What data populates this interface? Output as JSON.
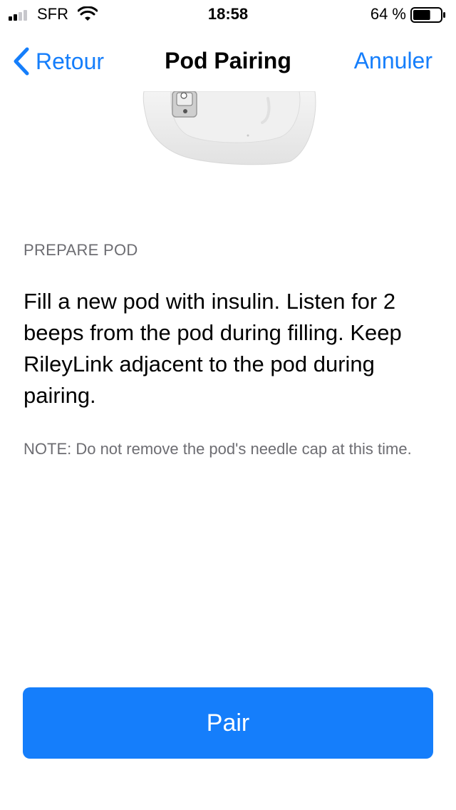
{
  "status_bar": {
    "carrier": "SFR",
    "time": "18:58",
    "battery_percent": "64 %",
    "battery_level": 0.64,
    "signal_bars": 2,
    "signal_icon": "cellular-signal-icon",
    "wifi_icon": "wifi-icon",
    "battery_icon": "battery-icon"
  },
  "nav": {
    "back_label": "Retour",
    "back_icon": "chevron-left-icon",
    "title": "Pod Pairing",
    "cancel_label": "Annuler"
  },
  "content": {
    "pod_image": "pod-illustration",
    "section_header": "PREPARE POD",
    "instructions": "Fill a new pod with insulin. Listen for 2 beeps from the pod during filling. Keep RileyLink adjacent to the pod during pairing.",
    "note": "NOTE: Do not remove the pod's needle cap at this time."
  },
  "actions": {
    "pair_label": "Pair"
  },
  "colors": {
    "accent": "#157efb",
    "secondary_text": "#6d6d72",
    "background": "#ffffff"
  }
}
